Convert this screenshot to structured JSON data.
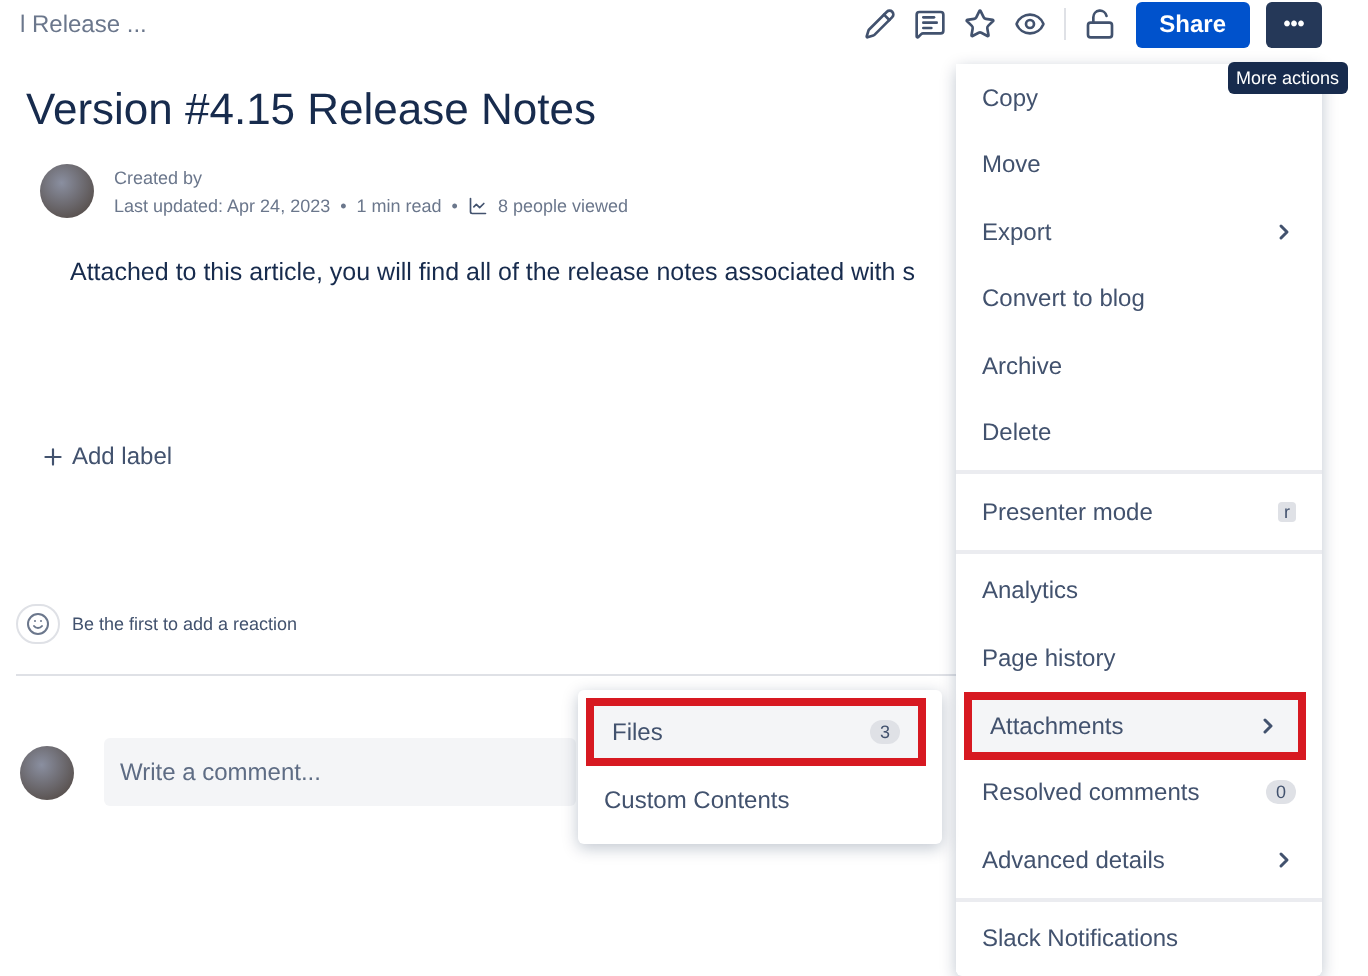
{
  "breadcrumb": "l Release ...",
  "toolbar": {
    "share": "Share",
    "more": "•••",
    "tooltip": "More actions"
  },
  "title": "Version #4.15 Release Notes",
  "meta": {
    "created_by": "Created by",
    "last_updated": "Last updated: Apr 24, 2023",
    "separator": "•",
    "read_time": "1 min read",
    "views": "8 people viewed"
  },
  "body": "Attached to this article, you will find all of the release notes associated with s",
  "add_label": "Add label",
  "reaction": "Be the first to add a reaction",
  "comment": {
    "placeholder": "Write a comment..."
  },
  "menu": {
    "groups": [
      [
        {
          "label": "Copy",
          "kind": "plain",
          "highlighted": false
        },
        {
          "label": "Move",
          "kind": "plain",
          "highlighted": false
        },
        {
          "label": "Export",
          "kind": "submenu",
          "highlighted": false
        },
        {
          "label": "Convert to blog",
          "kind": "plain",
          "highlighted": false
        },
        {
          "label": "Archive",
          "kind": "plain",
          "highlighted": false
        },
        {
          "label": "Delete",
          "kind": "plain",
          "highlighted": false
        }
      ],
      [
        {
          "label": "Presenter mode",
          "kind": "shortcut",
          "extra": "r",
          "highlighted": false
        }
      ],
      [
        {
          "label": "Analytics",
          "kind": "plain",
          "highlighted": false
        },
        {
          "label": "Page history",
          "kind": "plain",
          "highlighted": false
        },
        {
          "label": "Attachments",
          "kind": "submenu",
          "highlighted": true
        },
        {
          "label": "Resolved comments",
          "kind": "badge",
          "extra": "0",
          "highlighted": false
        },
        {
          "label": "Advanced details",
          "kind": "submenu",
          "highlighted": false
        }
      ],
      [
        {
          "label": "Slack Notifications",
          "kind": "plain",
          "highlighted": false
        }
      ]
    ]
  },
  "submenu": {
    "items": [
      {
        "label": "Files",
        "kind": "badge",
        "extra": "3",
        "highlighted": true
      },
      {
        "label": "Custom Contents",
        "kind": "plain",
        "highlighted": false
      }
    ]
  }
}
